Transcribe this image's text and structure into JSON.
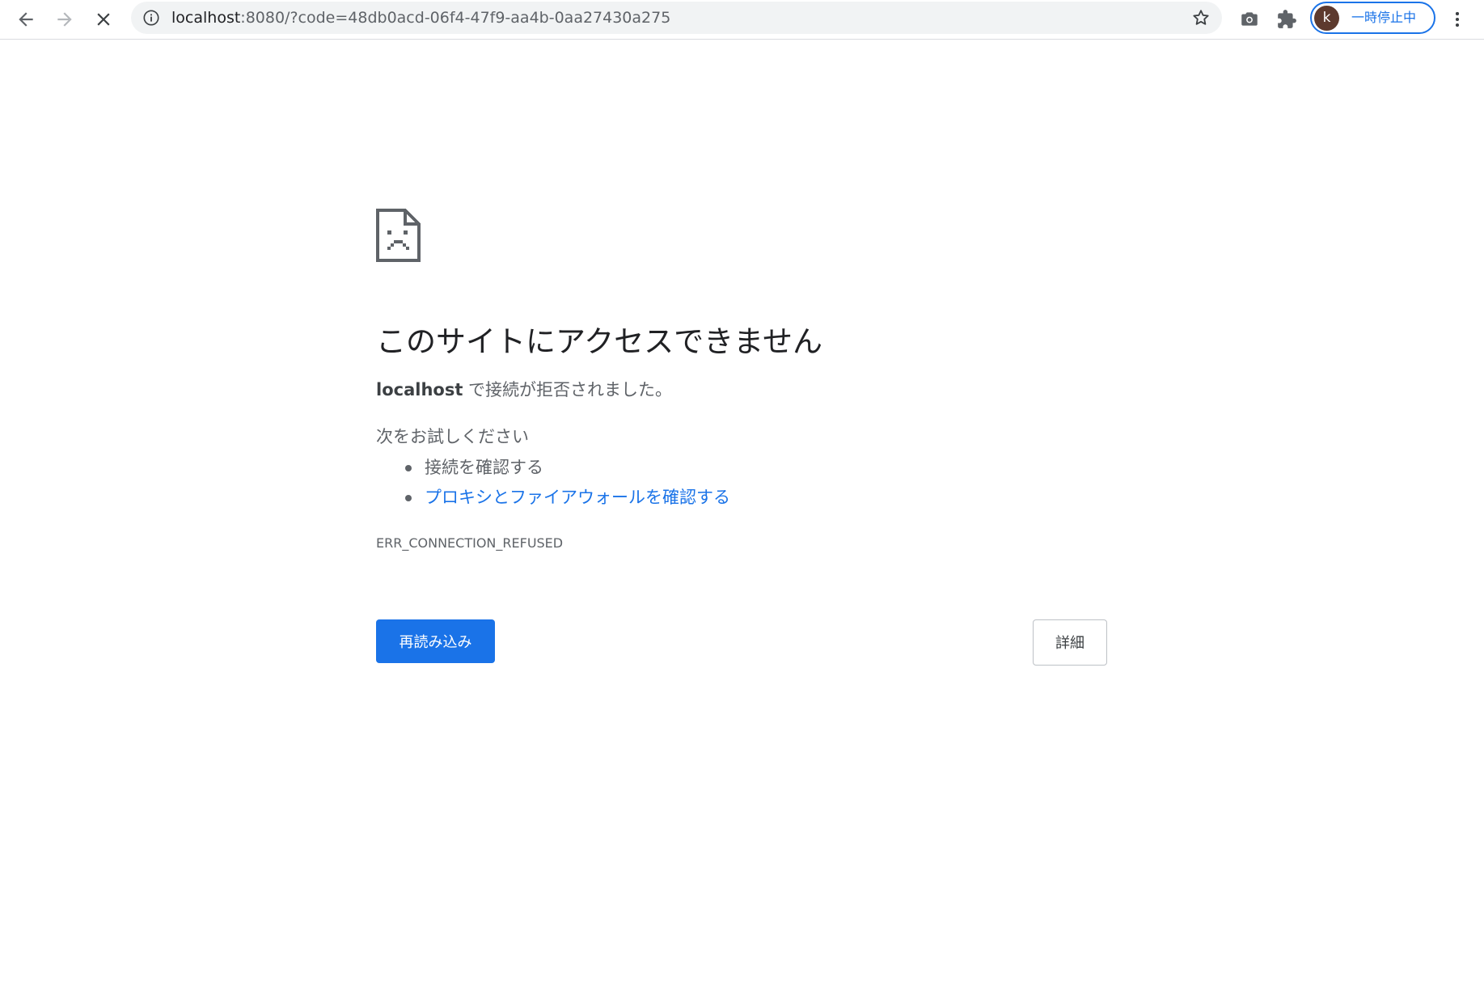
{
  "browser": {
    "url_host": "localhost",
    "url_rest": ":8080/?code=48db0acd-06f4-47f9-aa4b-0aa27430a275",
    "profile": {
      "initial": "k",
      "status_label": "一時停止中"
    },
    "icons": {
      "back": "arrow-left-icon",
      "forward": "arrow-right-icon",
      "stop": "close-icon",
      "site_info": "info-icon",
      "bookmark": "star-icon",
      "screenshot": "camera-icon",
      "extensions": "puzzle-icon",
      "menu": "more-vert-icon"
    }
  },
  "error_page": {
    "icon": "sad-page-icon",
    "headline": "このサイトにアクセスできません",
    "description_host": "localhost",
    "description_text": " で接続が拒否されました。",
    "try_title": "次をお試しください",
    "suggestions": [
      {
        "label": "接続を確認する",
        "is_link": false
      },
      {
        "label": "プロキシとファイアウォールを確認する",
        "is_link": true
      }
    ],
    "error_code": "ERR_CONNECTION_REFUSED",
    "reload_label": "再読み込み",
    "details_label": "詳細"
  },
  "colors": {
    "accent": "#1a73e8",
    "text_primary": "#202124",
    "text_secondary": "#5f6368"
  }
}
